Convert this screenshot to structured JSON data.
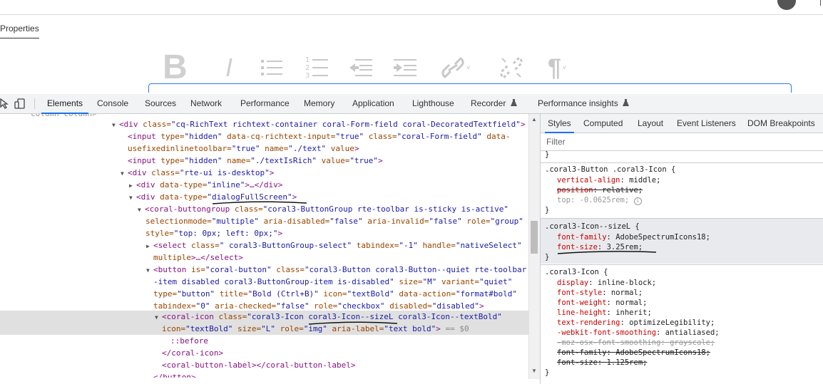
{
  "page": {
    "properties_tab": "Properties"
  },
  "rte_toolbar": {
    "buttons": [
      {
        "name": "bold",
        "glyph": "B"
      },
      {
        "name": "italic",
        "glyph": "I"
      },
      {
        "name": "bulleted-list",
        "glyph": "list"
      },
      {
        "name": "numbered-list",
        "glyph": "numlist",
        "digits": [
          "1",
          "2",
          "3"
        ]
      },
      {
        "name": "outdent",
        "glyph": "outdent"
      },
      {
        "name": "indent",
        "glyph": "indent"
      },
      {
        "name": "link",
        "glyph": "link",
        "caret": "˅"
      },
      {
        "name": "unlink",
        "glyph": "unlink"
      },
      {
        "name": "paragraph",
        "glyph": "¶",
        "caret": "˅"
      }
    ]
  },
  "devtools": {
    "tabs": [
      "Elements",
      "Console",
      "Sources",
      "Network",
      "Performance",
      "Memory",
      "Application",
      "Lighthouse",
      "Recorder",
      "Performance insights"
    ],
    "active_tab": "Elements",
    "colors": {
      "accent": "#1a73e8",
      "tag": "#881280",
      "attr_name": "#994500",
      "attr_value": "#1a1aa6",
      "property": "#c80000"
    }
  },
  "dom": {
    "top_cut": "column column>",
    "l1": {
      "tag": "<div",
      "a1": " class=",
      "v1": "\"cq-RichText richtext-container coral-Form-field coral-DecoratedTextfield\"",
      "end": ">"
    },
    "l2": {
      "tag": "<input",
      "a1": " type=",
      "v1": "\"hidden\"",
      "a2": " data-cq-richtext-input=",
      "v2": "\"true\"",
      "a3": " class=",
      "v3": "\"coral-Form-field\"",
      "a4": " data-"
    },
    "l3": {
      "a1": "usefixedinlinetoolbar=",
      "v1": "\"true\"",
      "a2": " name=",
      "v2": "\"./text\"",
      "a3": " value",
      "end": ">"
    },
    "l4": {
      "tag": "<input",
      "a1": " type=",
      "v1": "\"hidden\"",
      "a2": " name=",
      "v2": "\"./textIsRich\"",
      "a3": " value=",
      "v3": "\"true\"",
      "end": ">"
    },
    "l5": {
      "tag": "<div",
      "a1": " class=",
      "v1": "\"rte-ui is-desktop\"",
      "end": ">"
    },
    "l6": {
      "tag": "<div",
      "a1": " data-type=",
      "v1": "\"inline\"",
      "end": ">…</div>"
    },
    "l7": {
      "tag": "<div",
      "a1": " data-type=",
      "v1": "\"dialogFullScreen\"",
      "end": ">"
    },
    "l8": {
      "tag": "<coral-buttongroup",
      "a1": " class=",
      "v1": "\"coral3-ButtonGroup rte-toolbar is-sticky is-active\""
    },
    "l9": {
      "a1": "selectionmode=",
      "v1": "\"multiple\"",
      "a2": " aria-disabled=",
      "v2": "\"false\"",
      "a3": " aria-invalid=",
      "v3": "\"false\"",
      "a4": " role=",
      "v4": "\"group\""
    },
    "l10": {
      "a1": "style=",
      "v1": "\"top: 0px; left: 0px;\"",
      "end": ">"
    },
    "l11": {
      "tag": "<select",
      "a1": " class=",
      "v1": "\" coral3-ButtonGroup-select\"",
      "a2": " tabindex=",
      "v2": "\"-1\"",
      "a3": " handle=",
      "v3": "\"nativeSelect\""
    },
    "l12": {
      "a1": "multiple",
      "end": ">…</select>"
    },
    "l13": {
      "tag": "<button",
      "a1": " is=",
      "v1": "\"coral-button\"",
      "a2": " class=",
      "v2": "\"coral3-Button coral3-Button--quiet rte-toolbar"
    },
    "l14": {
      "v1": "-item disabled coral3-ButtonGroup-item is-disabled\"",
      "a1": " size=",
      "v2": "\"M\"",
      "a2": " variant=",
      "v3": "\"quiet\""
    },
    "l15": {
      "a1": "type=",
      "v1": "\"button\"",
      "a2": " title=",
      "v2": "\"Bold (Ctrl+B)\"",
      "a3": " icon=",
      "v3": "\"textBold\"",
      "a4": " data-action=",
      "v4": "\"format#bold\""
    },
    "l16": {
      "a1": "tabindex=",
      "v1": "\"0\"",
      "a2": " aria-checked=",
      "v2": "\"false\"",
      "a3": " role=",
      "v3": "\"checkbox\"",
      "a4": " disabled=",
      "v4": "\"disabled\"",
      "end": ">"
    },
    "l17": {
      "tag": "<coral-icon",
      "a1": " class=",
      "v1": "\"coral3-Icon coral3-Icon--sizeL coral3-Icon--textBold\""
    },
    "l18": {
      "a1": "icon=",
      "v1": "\"textBold\"",
      "a2": " size=",
      "v2": "\"L\"",
      "a3": " role=",
      "v3": "\"img\"",
      "a4": " aria-label=",
      "v4": "\"text bold\"",
      "end": ">",
      "eq": " == $0"
    },
    "l19": {
      "text": "::before"
    },
    "l20": {
      "tag": "</coral-icon>"
    },
    "l21": {
      "tag": "<coral-button-label></coral-button-label>"
    },
    "l22": {
      "tag": "</button>"
    }
  },
  "styles_pane": {
    "tabs": [
      "Styles",
      "Computed",
      "Layout",
      "Event Listeners",
      "DOM Breakpoints"
    ],
    "active_tab": "Styles",
    "filter_placeholder": "Filter",
    "rules": [
      {
        "selector": ".coral3-Button .coral3-Icon {",
        "decls": [
          {
            "prop": "vertical-align",
            "value": "middle;"
          },
          {
            "prop": "position",
            "value": "relative;",
            "struck": true
          },
          {
            "prop": "top",
            "value": "-0.0625rem;",
            "dim": true
          }
        ]
      },
      {
        "selector": ".coral3-Icon--sizeL {",
        "decls": [
          {
            "prop": "font-family",
            "value": "AdobeSpectrumIcons18;"
          },
          {
            "prop": "font-size",
            "value": "3.25rem;"
          }
        ]
      },
      {
        "selector": ".coral3-Icon {",
        "decls": [
          {
            "prop": "display",
            "value": "inline-block;"
          },
          {
            "prop": "font-style",
            "value": "normal;"
          },
          {
            "prop": "font-weight",
            "value": "normal;"
          },
          {
            "prop": "line-height",
            "value": "inherit;"
          },
          {
            "prop": "text-rendering",
            "value": "optimizeLegibility;"
          },
          {
            "prop": "-webkit-font-smoothing",
            "value": "antialiased;"
          },
          {
            "prop": "-moz-osx-font-smoothing",
            "value": "grayscale;",
            "struck": true,
            "dim": true
          },
          {
            "prop": "font-family",
            "value": "AdobeSpectrumIcons18;",
            "struck": true
          },
          {
            "prop": "font-size",
            "value": "1.125rem;",
            "struck": true
          }
        ]
      }
    ],
    "close_brace": "}"
  }
}
